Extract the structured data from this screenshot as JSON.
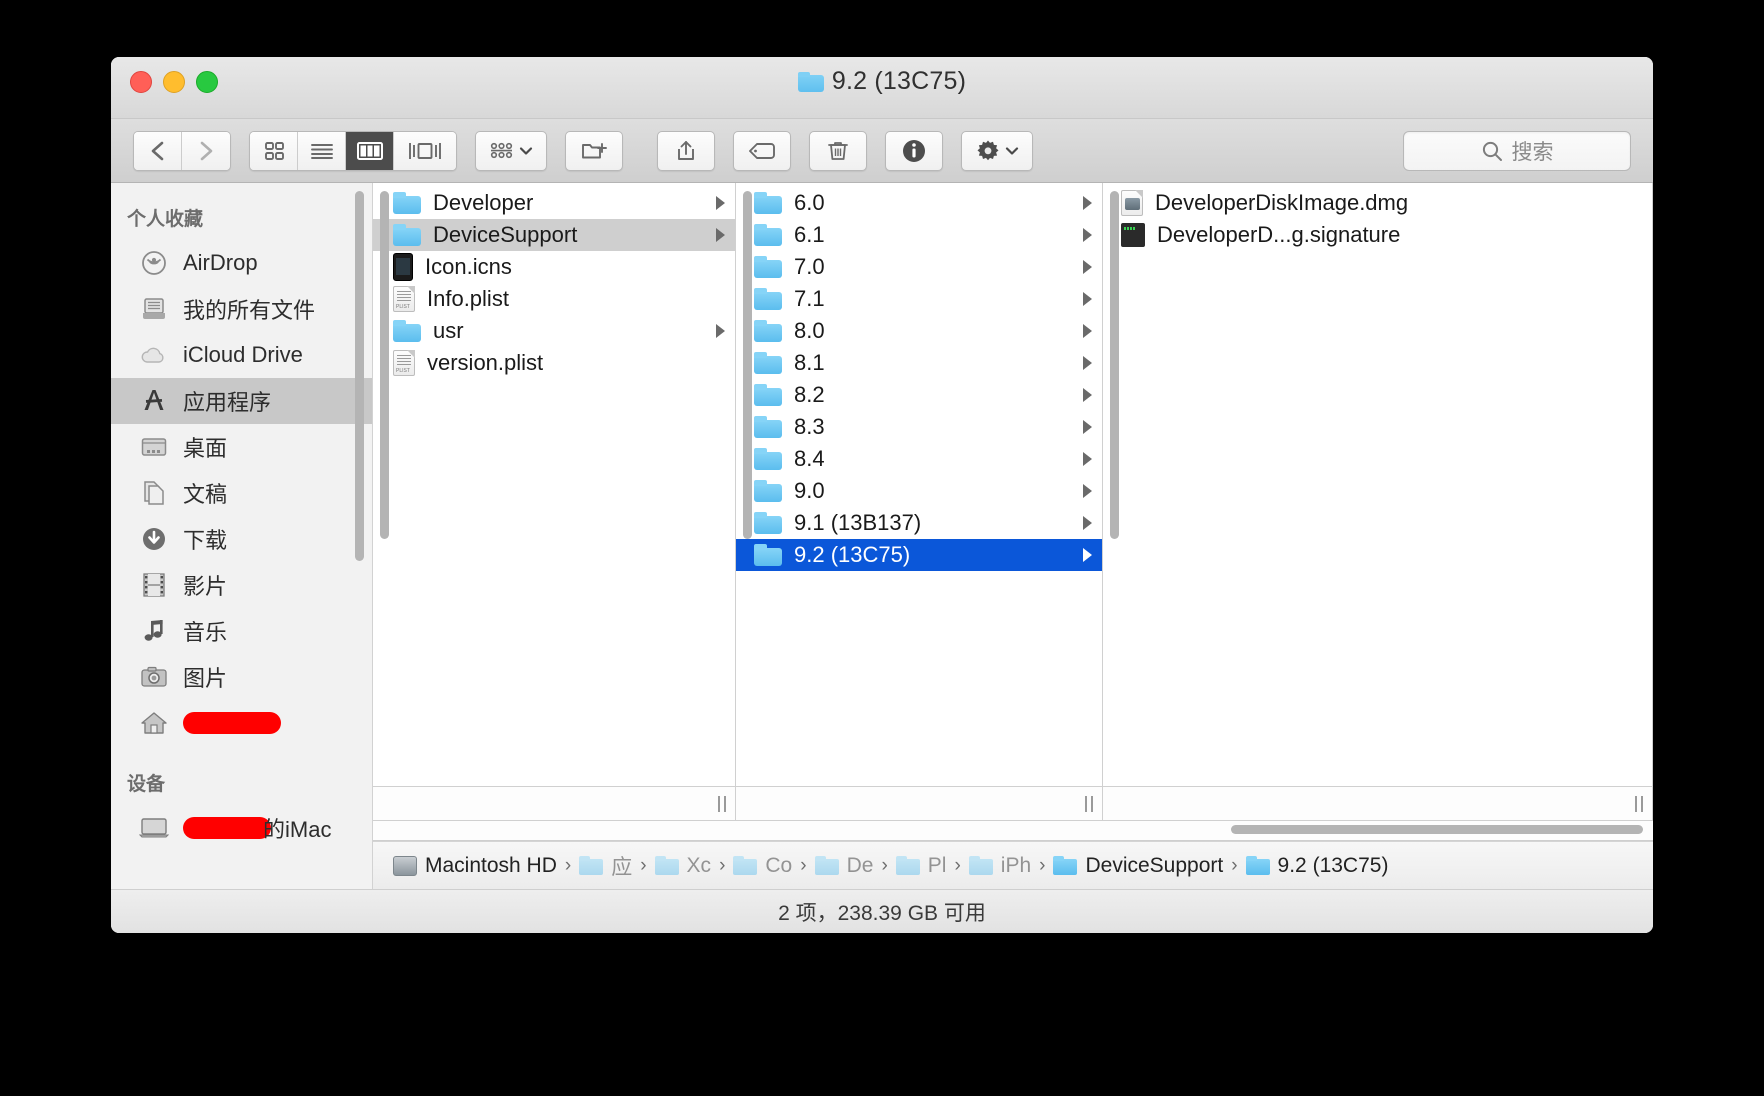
{
  "window": {
    "title": "9.2 (13C75)",
    "title_icon": "folder-icon"
  },
  "toolbar": {
    "back_label": "back-icon",
    "forward_label": "forward-icon",
    "view_icon_label": "icon-view",
    "view_list_label": "list-view",
    "view_column_label": "column-view",
    "view_coverflow_label": "coverflow-view",
    "arrange_label": "arrange-icon",
    "newfolder_label": "new-folder-icon",
    "share_label": "share-icon",
    "tag_label": "tag-icon",
    "delete_label": "trash-icon",
    "info_label": "info-icon",
    "action_label": "gear-icon",
    "search_placeholder": "搜索"
  },
  "sidebar": {
    "sections": [
      {
        "header": "个人收藏",
        "items": [
          {
            "label": "AirDrop",
            "icon": "airdrop-icon",
            "selected": false,
            "redacted": false
          },
          {
            "label": "我的所有文件",
            "icon": "all-files-icon",
            "selected": false,
            "redacted": false
          },
          {
            "label": "iCloud Drive",
            "icon": "icloud-icon",
            "selected": false,
            "redacted": false
          },
          {
            "label": "应用程序",
            "icon": "applications-icon",
            "selected": true,
            "redacted": false
          },
          {
            "label": "桌面",
            "icon": "desktop-icon",
            "selected": false,
            "redacted": false
          },
          {
            "label": "文稿",
            "icon": "documents-icon",
            "selected": false,
            "redacted": false
          },
          {
            "label": "下载",
            "icon": "downloads-icon",
            "selected": false,
            "redacted": false
          },
          {
            "label": "影片",
            "icon": "movies-icon",
            "selected": false,
            "redacted": false
          },
          {
            "label": "音乐",
            "icon": "music-icon",
            "selected": false,
            "redacted": false
          },
          {
            "label": "图片",
            "icon": "pictures-icon",
            "selected": false,
            "redacted": false
          },
          {
            "label": "",
            "icon": "home-icon",
            "selected": false,
            "redacted": true
          }
        ]
      },
      {
        "header": "设备",
        "items": [
          {
            "label": "的iMac",
            "icon": "imac-icon",
            "selected": false,
            "redacted": true
          }
        ]
      }
    ]
  },
  "columns": [
    {
      "name": "column-1",
      "rows": [
        {
          "label": "Developer",
          "icon": "folder-icon",
          "expandable": true,
          "state": "none"
        },
        {
          "label": "DeviceSupport",
          "icon": "folder-icon",
          "expandable": true,
          "state": "selected-inactive"
        },
        {
          "label": "Icon.icns",
          "icon": "phone-icon",
          "expandable": false,
          "state": "none"
        },
        {
          "label": "Info.plist",
          "icon": "plist-icon",
          "expandable": false,
          "state": "none"
        },
        {
          "label": "usr",
          "icon": "folder-icon",
          "expandable": true,
          "state": "none"
        },
        {
          "label": "version.plist",
          "icon": "plist-icon",
          "expandable": false,
          "state": "none"
        }
      ]
    },
    {
      "name": "column-2",
      "rows": [
        {
          "label": "6.0",
          "icon": "folder-icon",
          "expandable": true,
          "state": "none"
        },
        {
          "label": "6.1",
          "icon": "folder-icon",
          "expandable": true,
          "state": "none"
        },
        {
          "label": "7.0",
          "icon": "folder-icon",
          "expandable": true,
          "state": "none"
        },
        {
          "label": "7.1",
          "icon": "folder-icon",
          "expandable": true,
          "state": "none"
        },
        {
          "label": "8.0",
          "icon": "folder-icon",
          "expandable": true,
          "state": "none"
        },
        {
          "label": "8.1",
          "icon": "folder-icon",
          "expandable": true,
          "state": "none"
        },
        {
          "label": "8.2",
          "icon": "folder-icon",
          "expandable": true,
          "state": "none"
        },
        {
          "label": "8.3",
          "icon": "folder-icon",
          "expandable": true,
          "state": "none"
        },
        {
          "label": "8.4",
          "icon": "folder-icon",
          "expandable": true,
          "state": "none"
        },
        {
          "label": "9.0",
          "icon": "folder-icon",
          "expandable": true,
          "state": "none"
        },
        {
          "label": "9.1 (13B137)",
          "icon": "folder-icon",
          "expandable": true,
          "state": "none"
        },
        {
          "label": "9.2 (13C75)",
          "icon": "folder-icon",
          "expandable": true,
          "state": "selected-active"
        }
      ]
    },
    {
      "name": "column-3",
      "rows": [
        {
          "label": "DeveloperDiskImage.dmg",
          "icon": "dmg-icon",
          "expandable": false,
          "state": "none"
        },
        {
          "label": "DeveloperD...g.signature",
          "icon": "signature-icon",
          "expandable": false,
          "state": "none"
        }
      ]
    }
  ],
  "pathbar": {
    "items": [
      {
        "label": "Macintosh HD",
        "icon": "disk-icon",
        "faded": false
      },
      {
        "label": "应",
        "icon": "applications-icon",
        "faded": true
      },
      {
        "label": "Xc",
        "icon": "xcode-icon",
        "faded": true
      },
      {
        "label": "Co",
        "icon": "folder-icon",
        "faded": true
      },
      {
        "label": "De",
        "icon": "folder-icon",
        "faded": true
      },
      {
        "label": "Pl",
        "icon": "folder-icon",
        "faded": true
      },
      {
        "label": "iPh",
        "icon": "folder-icon",
        "faded": true
      },
      {
        "label": "DeviceSupport",
        "icon": "folder-icon",
        "faded": false
      },
      {
        "label": "9.2 (13C75)",
        "icon": "folder-icon",
        "faded": false
      }
    ],
    "separator": "›"
  },
  "statusbar": {
    "text": "2 项，238.39 GB 可用"
  },
  "colors": {
    "selection_blue": "#0b57d9",
    "selection_gray": "#cfcfcf",
    "folder_blue": "#5bbdee",
    "redaction_red": "#ff0000",
    "toolbar_active": "#4c4c4c"
  }
}
